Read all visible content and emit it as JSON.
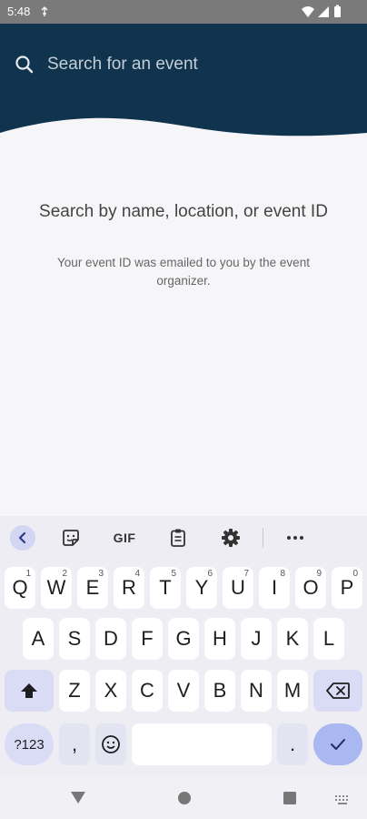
{
  "status_bar": {
    "time": "5:48"
  },
  "search": {
    "placeholder": "Search for an event"
  },
  "empty_state": {
    "title": "Search by name, location, or event ID",
    "subtitle": "Your event ID was emailed to you by the event organizer."
  },
  "keyboard": {
    "toolbar": {
      "gif_label": "GIF"
    },
    "row1": [
      {
        "label": "Q",
        "sup": "1"
      },
      {
        "label": "W",
        "sup": "2"
      },
      {
        "label": "E",
        "sup": "3"
      },
      {
        "label": "R",
        "sup": "4"
      },
      {
        "label": "T",
        "sup": "5"
      },
      {
        "label": "Y",
        "sup": "6"
      },
      {
        "label": "U",
        "sup": "7"
      },
      {
        "label": "I",
        "sup": "8"
      },
      {
        "label": "O",
        "sup": "9"
      },
      {
        "label": "P",
        "sup": "0"
      }
    ],
    "row2": [
      "A",
      "S",
      "D",
      "F",
      "G",
      "H",
      "J",
      "K",
      "L"
    ],
    "row3": [
      "Z",
      "X",
      "C",
      "V",
      "B",
      "N",
      "M"
    ],
    "row4": {
      "num_label": "?123",
      "comma": ",",
      "period": "."
    }
  },
  "colors": {
    "header_bg": "#10344e",
    "page_bg": "#f6f5f8",
    "keyboard_bg": "#eeedf3",
    "accent_key": "#a9b8f0"
  },
  "icons": [
    "search-icon",
    "chevron-left-icon",
    "sticker-icon",
    "clipboard-icon",
    "gear-icon",
    "more-icon",
    "shift-icon",
    "backspace-icon",
    "emoji-icon",
    "check-icon",
    "back-triangle-icon",
    "home-circle-icon",
    "recents-square-icon",
    "keyboard-icon",
    "wifi-icon",
    "signal-icon",
    "battery-icon"
  ]
}
